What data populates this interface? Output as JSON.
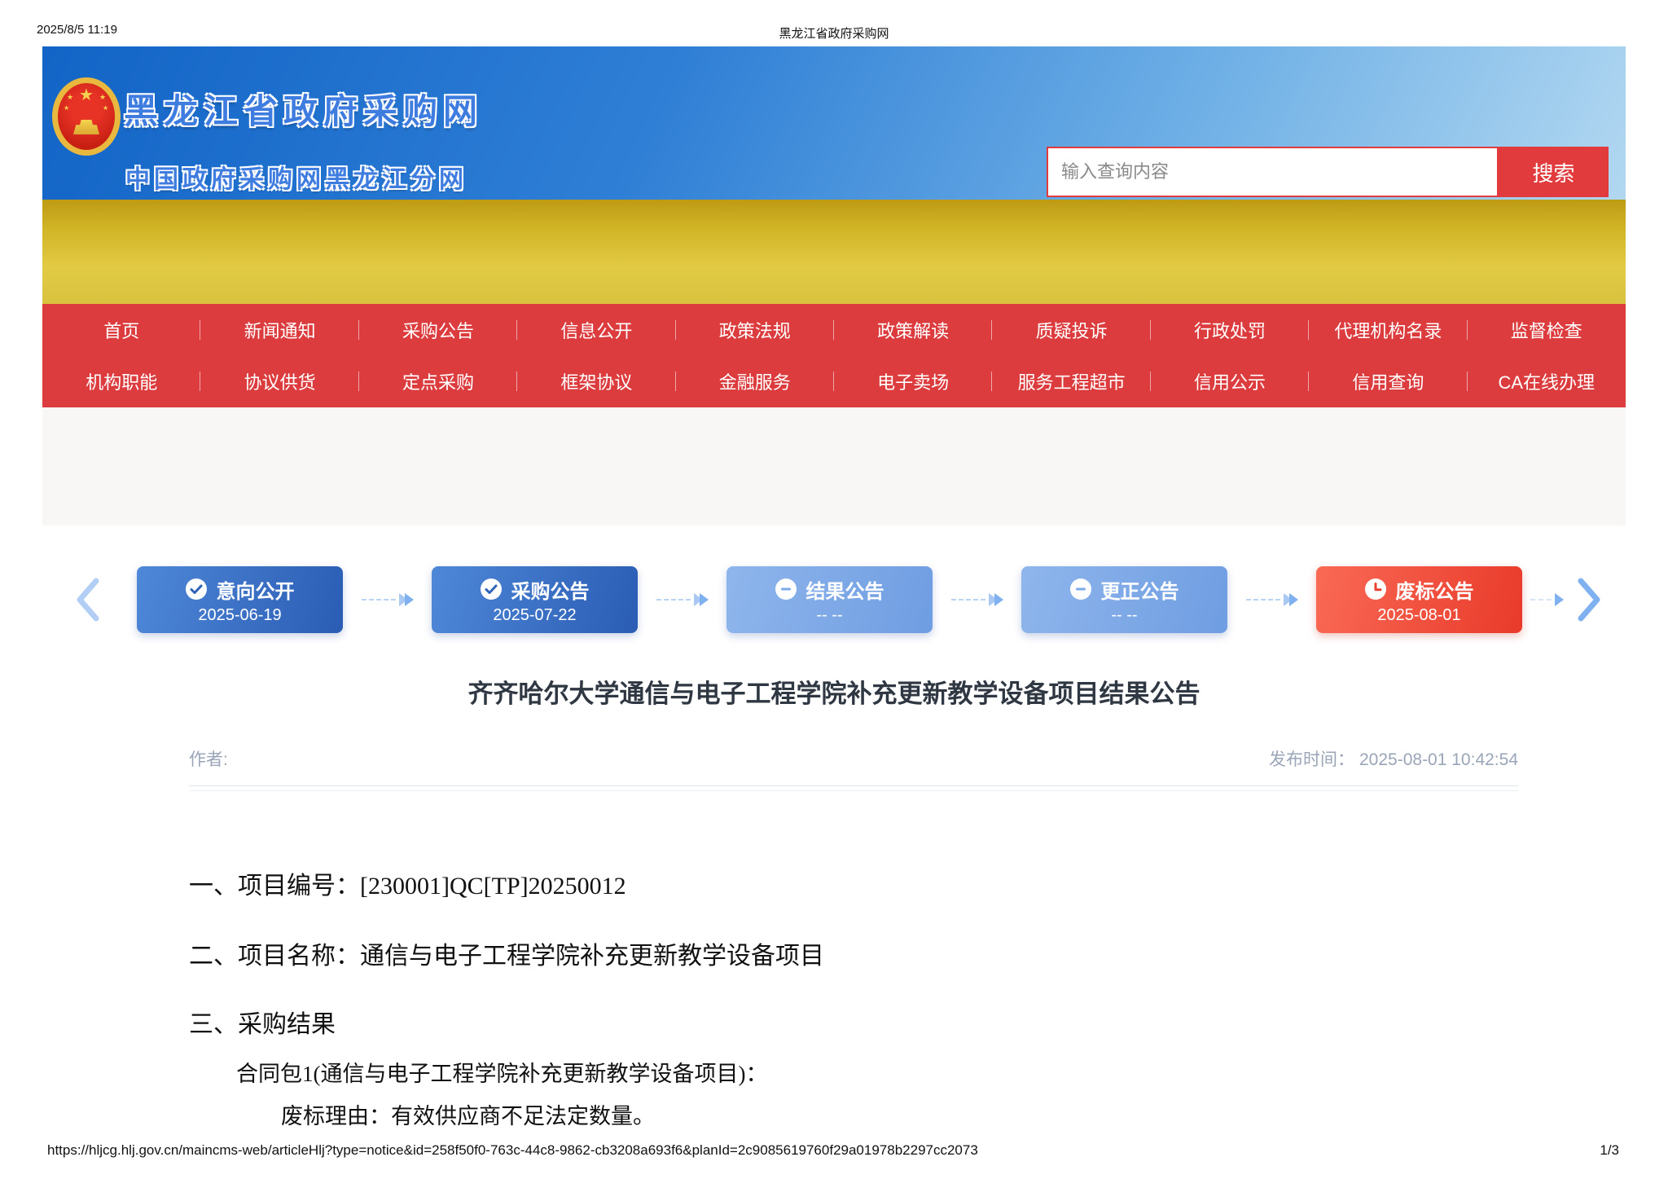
{
  "print_header": {
    "datetime": "2025/8/5 11:19",
    "title": "黑龙江省政府采购网"
  },
  "banner": {
    "site_title": "黑龙江省政府采购网",
    "site_subtitle": "中国政府采购网黑龙江分网",
    "search": {
      "placeholder": "输入查询内容",
      "button_label": "搜索"
    }
  },
  "nav": {
    "row1": [
      "首页",
      "新闻通知",
      "采购公告",
      "信息公开",
      "政策法规",
      "政策解读",
      "质疑投诉",
      "行政处罚",
      "代理机构名录",
      "监督检查"
    ],
    "row2": [
      "机构职能",
      "协议供货",
      "定点采购",
      "框架协议",
      "金融服务",
      "电子卖场",
      "服务工程超市",
      "信用公示",
      "信用查询",
      "CA在线办理"
    ]
  },
  "timeline": {
    "steps": [
      {
        "label": "意向公开",
        "date": "2025-06-19",
        "status": "done",
        "icon": "check-icon"
      },
      {
        "label": "采购公告",
        "date": "2025-07-22",
        "status": "done",
        "icon": "check-icon"
      },
      {
        "label": "结果公告",
        "date": "-- --",
        "status": "pending",
        "icon": "minus-icon"
      },
      {
        "label": "更正公告",
        "date": "-- --",
        "status": "pending",
        "icon": "minus-icon"
      },
      {
        "label": "废标公告",
        "date": "2025-08-01",
        "status": "alert",
        "icon": "clock-icon"
      }
    ]
  },
  "article": {
    "title": "齐齐哈尔大学通信与电子工程学院补充更新教学设备项目结果公告",
    "author_label": "作者:",
    "publish_label": "发布时间：",
    "publish_time": "2025-08-01 10:42:54",
    "paragraphs": [
      "一、项目编号：[230001]QC[TP]20250012",
      "二、项目名称：通信与电子工程学院补充更新教学设备项目",
      "三、采购结果",
      "合同包1(通信与电子工程学院补充更新教学设备项目)：",
      "废标理由：有效供应商不足法定数量。"
    ]
  },
  "print_footer": {
    "url": "https://hljcg.hlj.gov.cn/maincms-web/articleHlj?type=notice&id=258f50f0-763c-44c8-9862-cb3208a693f6&planId=2c9085619760f29a01978b2297cc2073",
    "page": "1/3"
  },
  "colors": {
    "nav_red": "#dc3c3e",
    "search_red": "#e13b3d",
    "banner_title_blue": "#3f7ce0",
    "step_done_blue": "#2e63b8",
    "step_pending_blue": "#7ca9e8",
    "step_alert_red": "#ee4132",
    "band_gray": "#f8f7f5"
  }
}
